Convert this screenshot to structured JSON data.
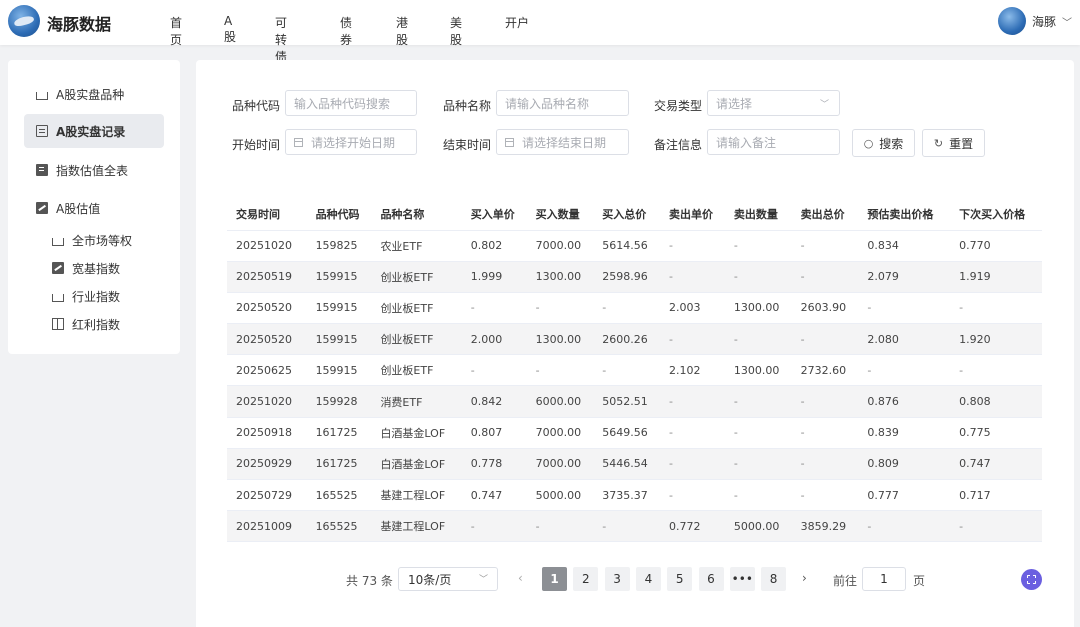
{
  "header": {
    "brand": "海豚数据",
    "nav": [
      "首页",
      "A股",
      "可转债",
      "债券",
      "港股",
      "美股",
      "开户"
    ],
    "user": "海豚"
  },
  "sidebar": {
    "items": [
      {
        "label": "A股实盘品种",
        "icon": "basket-icon"
      },
      {
        "label": "A股实盘记录",
        "icon": "document-icon",
        "active": true
      },
      {
        "label": "指数估值全表",
        "icon": "clipboard-icon"
      },
      {
        "label": "A股估值",
        "icon": "trend-chart-icon"
      }
    ],
    "subitems": [
      {
        "label": "全市场等权",
        "icon": "basket-icon"
      },
      {
        "label": "宽基指数",
        "icon": "trend-chart-icon"
      },
      {
        "label": "行业指数",
        "icon": "basket-icon"
      },
      {
        "label": "红利指数",
        "icon": "gift-icon"
      }
    ]
  },
  "filters": {
    "code_label": "品种代码",
    "code_placeholder": "输入品种代码搜索",
    "name_label": "品种名称",
    "name_placeholder": "请输入品种名称",
    "type_label": "交易类型",
    "type_placeholder": "请选择",
    "start_label": "开始时间",
    "start_placeholder": "请选择开始日期",
    "end_label": "结束时间",
    "end_placeholder": "请选择结束日期",
    "note_label": "备注信息",
    "note_placeholder": "请输入备注",
    "search_button": "搜索",
    "reset_button": "重置"
  },
  "table": {
    "columns": [
      "交易时间",
      "品种代码",
      "品种名称",
      "买入单价",
      "买入数量",
      "买入总价",
      "卖出单价",
      "卖出数量",
      "卖出总价",
      "预估卖出价格",
      "下次买入价格"
    ],
    "rows": [
      [
        "20251020",
        "159825",
        "农业ETF",
        "0.802",
        "7000.00",
        "5614.56",
        "-",
        "-",
        "-",
        "0.834",
        "0.770"
      ],
      [
        "20250519",
        "159915",
        "创业板ETF",
        "1.999",
        "1300.00",
        "2598.96",
        "-",
        "-",
        "-",
        "2.079",
        "1.919"
      ],
      [
        "20250520",
        "159915",
        "创业板ETF",
        "-",
        "-",
        "-",
        "2.003",
        "1300.00",
        "2603.90",
        "-",
        "-"
      ],
      [
        "20250520",
        "159915",
        "创业板ETF",
        "2.000",
        "1300.00",
        "2600.26",
        "-",
        "-",
        "-",
        "2.080",
        "1.920"
      ],
      [
        "20250625",
        "159915",
        "创业板ETF",
        "-",
        "-",
        "-",
        "2.102",
        "1300.00",
        "2732.60",
        "-",
        "-"
      ],
      [
        "20251020",
        "159928",
        "消费ETF",
        "0.842",
        "6000.00",
        "5052.51",
        "-",
        "-",
        "-",
        "0.876",
        "0.808"
      ],
      [
        "20250918",
        "161725",
        "白酒基金LOF",
        "0.807",
        "7000.00",
        "5649.56",
        "-",
        "-",
        "-",
        "0.839",
        "0.775"
      ],
      [
        "20250929",
        "161725",
        "白酒基金LOF",
        "0.778",
        "7000.00",
        "5446.54",
        "-",
        "-",
        "-",
        "0.809",
        "0.747"
      ],
      [
        "20250729",
        "165525",
        "基建工程LOF",
        "0.747",
        "5000.00",
        "3735.37",
        "-",
        "-",
        "-",
        "0.777",
        "0.717"
      ],
      [
        "20251009",
        "165525",
        "基建工程LOF",
        "-",
        "-",
        "-",
        "0.772",
        "5000.00",
        "3859.29",
        "-",
        "-"
      ]
    ]
  },
  "pagination": {
    "total": "共 73 条",
    "page_size": "10条/页",
    "prev": "‹",
    "next": "›",
    "pages": [
      "1",
      "2",
      "3",
      "4",
      "5",
      "6",
      "•••",
      "8"
    ],
    "current": "1",
    "goto_label": "前往",
    "goto_value": "1",
    "goto_suffix": "页"
  },
  "colors": {
    "accent": "#6b5fe0",
    "active_page": "#8c8f94"
  }
}
